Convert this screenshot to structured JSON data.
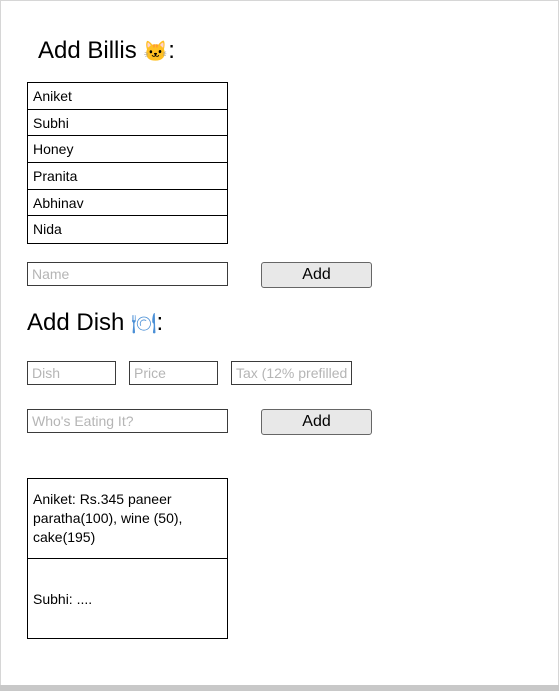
{
  "billis_section": {
    "title": "Add Billis",
    "icon": "cat-face-icon",
    "icon_glyph": "🐱",
    "colon": ":",
    "names": [
      "Aniket",
      "Subhi",
      "Honey",
      "Pranita",
      "Abhinav",
      "Nida"
    ],
    "name_input": {
      "value": "",
      "placeholder": "Name"
    },
    "add_label": "Add"
  },
  "dish_section": {
    "title": "Add Dish",
    "icon": "plate-fork-knife-icon",
    "icon_glyph": "🍽",
    "colon": ":",
    "dish_input": {
      "value": "",
      "placeholder": "Dish"
    },
    "price_input": {
      "value": "",
      "placeholder": "Price"
    },
    "tax_input": {
      "value": "",
      "placeholder": "Tax (12% prefilled)"
    },
    "eaters_input": {
      "value": "",
      "placeholder": "Who's Eating It?"
    },
    "add_label": "Add"
  },
  "summary": [
    "Aniket: Rs.345 paneer paratha(100), wine (50), cake(195)",
    "Subhi: ...."
  ],
  "colors": {
    "button_bg": "#e8e8e8",
    "icon_blue": "#4a8fd6"
  }
}
